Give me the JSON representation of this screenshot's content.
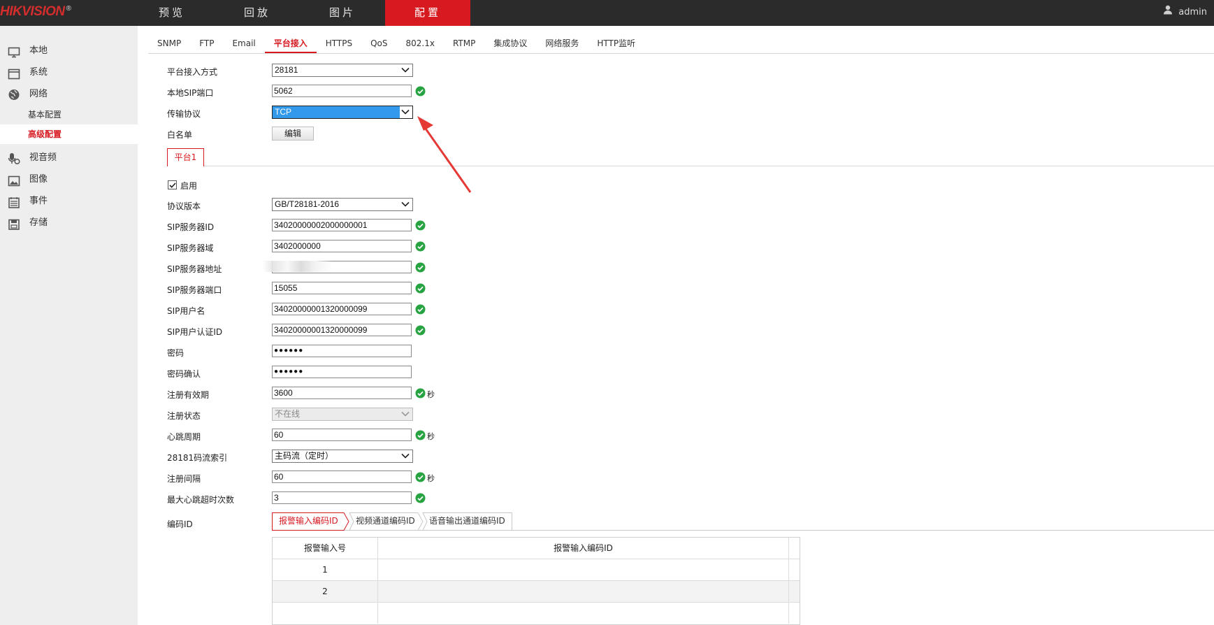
{
  "brand": {
    "name": "HIKVISION",
    "mark": "®"
  },
  "main_nav": [
    {
      "label": "预览",
      "active": false
    },
    {
      "label": "回放",
      "active": false
    },
    {
      "label": "图片",
      "active": false
    },
    {
      "label": "配置",
      "active": true
    }
  ],
  "user": {
    "name": "admin",
    "icon": "user-icon"
  },
  "sidebar": {
    "items": [
      {
        "label": "本地",
        "icon": "monitor-icon"
      },
      {
        "label": "系统",
        "icon": "system-window-icon"
      },
      {
        "label": "网络",
        "icon": "globe-icon"
      },
      {
        "label": "视音频",
        "icon": "microphone-camera-icon"
      },
      {
        "label": "图像",
        "icon": "image-icon"
      },
      {
        "label": "事件",
        "icon": "calendar-icon"
      },
      {
        "label": "存储",
        "icon": "disk-icon"
      }
    ],
    "network_sub": [
      {
        "label": "基本配置",
        "active": false
      },
      {
        "label": "高级配置",
        "active": true
      }
    ]
  },
  "tabs": [
    "SNMP",
    "FTP",
    "Email",
    "平台接入",
    "HTTPS",
    "QoS",
    "802.1x",
    "RTMP",
    "集成协议",
    "网络服务",
    "HTTP监听"
  ],
  "active_tab": "平台接入",
  "form": {
    "access_mode": {
      "label": "平台接入方式",
      "value": "28181"
    },
    "local_sip_port": {
      "label": "本地SIP端口",
      "value": "5062"
    },
    "transport": {
      "label": "传输协议",
      "value": "TCP"
    },
    "whitelist": {
      "label": "白名单",
      "button": "编辑"
    }
  },
  "platform_tab": "平台1",
  "enable": {
    "label": "启用",
    "checked": true
  },
  "platform": {
    "protocol_version": {
      "label": "协议版本",
      "value": "GB/T28181-2016"
    },
    "sip_server_id": {
      "label": "SIP服务器ID",
      "value": "34020000002000000001"
    },
    "sip_server_domain": {
      "label": "SIP服务器域",
      "value": "3402000000"
    },
    "sip_server_addr": {
      "label": "SIP服务器地址",
      "value": ""
    },
    "sip_server_port": {
      "label": "SIP服务器端口",
      "value": "15055"
    },
    "sip_username": {
      "label": "SIP用户名",
      "value": "34020000001320000099"
    },
    "sip_auth_id": {
      "label": "SIP用户认证ID",
      "value": "34020000001320000099"
    },
    "password": {
      "label": "密码",
      "value": "●●●●●●"
    },
    "password_confirm": {
      "label": "密码确认",
      "value": "●●●●●●"
    },
    "reg_validity": {
      "label": "注册有效期",
      "value": "3600",
      "unit": "秒"
    },
    "reg_status": {
      "label": "注册状态",
      "value": "不在线"
    },
    "heartbeat": {
      "label": "心跳周期",
      "value": "60",
      "unit": "秒"
    },
    "stream_index": {
      "label": "28181码流索引",
      "value": "主码流（定时）"
    },
    "reg_interval": {
      "label": "注册间隔",
      "value": "60",
      "unit": "秒"
    },
    "max_heartbeat_timeouts": {
      "label": "最大心跳超时次数",
      "value": "3"
    }
  },
  "encode_id": {
    "label": "编码ID",
    "tabs": [
      "报警输入编码ID",
      "视频通道编码ID",
      "语音输出通道编码ID"
    ],
    "active_tab": "报警输入编码ID",
    "table": {
      "headers": [
        "报警输入号",
        "报警输入编码ID"
      ],
      "rows": [
        [
          "1",
          ""
        ],
        [
          "2",
          ""
        ],
        [
          "",
          ""
        ]
      ]
    }
  },
  "colors": {
    "accent": "#d71920",
    "topbar": "#2b2b2b",
    "ok": "#27a342",
    "highlight": "#3399ea",
    "annotation": "#e53935"
  }
}
